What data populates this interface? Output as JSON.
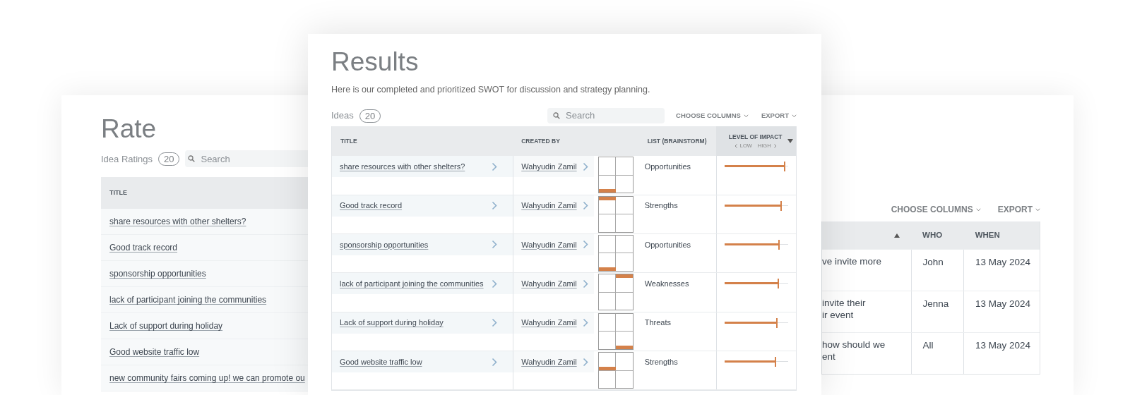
{
  "rate_panel": {
    "title": "Rate",
    "count_label": "Idea Ratings",
    "count": "20",
    "search": {
      "placeholder": "Search"
    },
    "table": {
      "columns": [
        "TITLE"
      ],
      "rows": [
        {
          "title": "share resources with other shelters?"
        },
        {
          "title": "Good track record"
        },
        {
          "title": "sponsorship opportunities"
        },
        {
          "title": "lack of participant joining the communities"
        },
        {
          "title": "Lack of support during holiday"
        },
        {
          "title": "Good website traffic low"
        },
        {
          "title": "new community fairs coming up! we can promote ou"
        }
      ]
    }
  },
  "actions_panel": {
    "toolbar": [
      "CHOOSE COLUMNS",
      "EXPORT"
    ],
    "table": {
      "columns": [
        {
          "sorted_ascending": true
        },
        {
          "label": "WHO"
        },
        {
          "label": "WHEN"
        }
      ],
      "rows": [
        {
          "lines": [
            "ve invite more"
          ],
          "who": "John",
          "when": "13 May 2024"
        },
        {
          "lines": [
            "invite their",
            "ir event"
          ],
          "who": "Jenna",
          "when": "13 May 2024"
        },
        {
          "lines": [
            "how should we",
            "ent"
          ],
          "who": "All",
          "when": "13 May 2024"
        }
      ]
    }
  },
  "results_panel": {
    "title": "Results",
    "description": "Here is our completed and prioritized SWOT for discussion and strategy planning.",
    "count_label": "Ideas",
    "count": "20",
    "search": {
      "placeholder": "Search"
    },
    "toolbar": [
      "CHOOSE COLUMNS",
      "EXPORT"
    ],
    "table": {
      "columns": [
        {
          "label": "TITLE"
        },
        {
          "label": "CREATED BY"
        },
        {
          "label": "LIST (BRAINSTORM)"
        },
        {
          "label": "LEVEL OF IMPACT",
          "low": "LOW",
          "high": "HIGH",
          "sorted_descending": true
        }
      ],
      "rows": [
        {
          "title": "share resources with other shelters?",
          "created_by": "Wahyudin Zamil",
          "marker_upper": false,
          "marker_right": false,
          "marker_at_top": false,
          "list": "Opportunities",
          "level": 0.94
        },
        {
          "title": "Good track record",
          "created_by": "Wahyudin Zamil",
          "marker_upper": true,
          "marker_right": false,
          "marker_at_top": true,
          "list": "Strengths",
          "level": 0.88
        },
        {
          "title": "sponsorship opportunities",
          "created_by": "Wahyudin Zamil",
          "marker_upper": false,
          "marker_right": false,
          "marker_at_top": false,
          "list": "Opportunities",
          "level": 0.85
        },
        {
          "title": "lack of participant joining the communities",
          "created_by": "Wahyudin Zamil",
          "marker_upper": true,
          "marker_right": true,
          "marker_at_top": true,
          "list": "Weaknesses",
          "level": 0.84
        },
        {
          "title": "Lack of support during holiday",
          "created_by": "Wahyudin Zamil",
          "marker_upper": false,
          "marker_right": true,
          "marker_at_top": false,
          "list": "Threats",
          "level": 0.82
        },
        {
          "title": "Good website traffic low",
          "created_by": "Wahyudin Zamil",
          "marker_upper": true,
          "marker_right": false,
          "marker_at_top": false,
          "list": "Strengths",
          "level": 0.8
        }
      ]
    }
  }
}
